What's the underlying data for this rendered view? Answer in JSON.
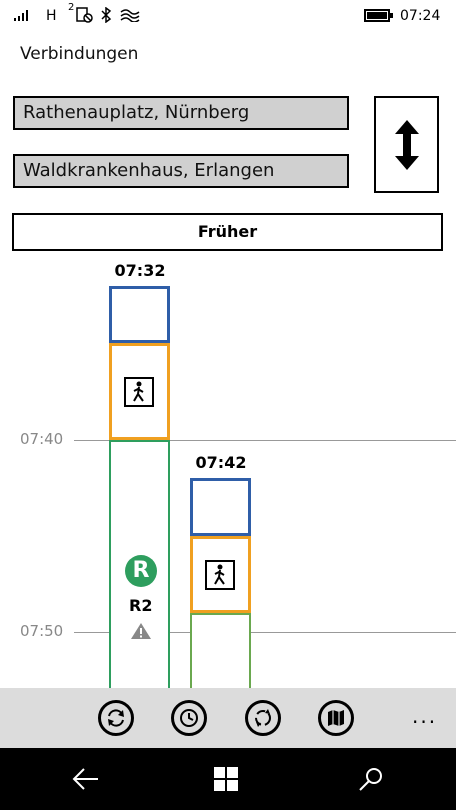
{
  "status_bar": {
    "network": "H",
    "sim_badge": "2",
    "time": "07:24"
  },
  "page": {
    "title": "Verbindungen"
  },
  "route": {
    "from": "Rathenauplatz, Nürnberg",
    "to": "Waldkrankenhaus, Erlangen"
  },
  "earlier_button": {
    "label": "Früher"
  },
  "timeline": {
    "time_labels": [
      "07:40",
      "07:50"
    ],
    "connections": [
      {
        "departure": "07:32",
        "line_badge": "R",
        "line": "R2"
      },
      {
        "departure": "07:42"
      }
    ]
  },
  "app_bar": {
    "buttons": [
      "refresh-icon",
      "clock-icon",
      "sync-icon",
      "map-icon"
    ],
    "more": "..."
  },
  "colors": {
    "transfer": "#2f5ea8",
    "walk": "#f0a020",
    "regional_train": "#2e9e5e",
    "second_leg": "#6aa84f"
  }
}
